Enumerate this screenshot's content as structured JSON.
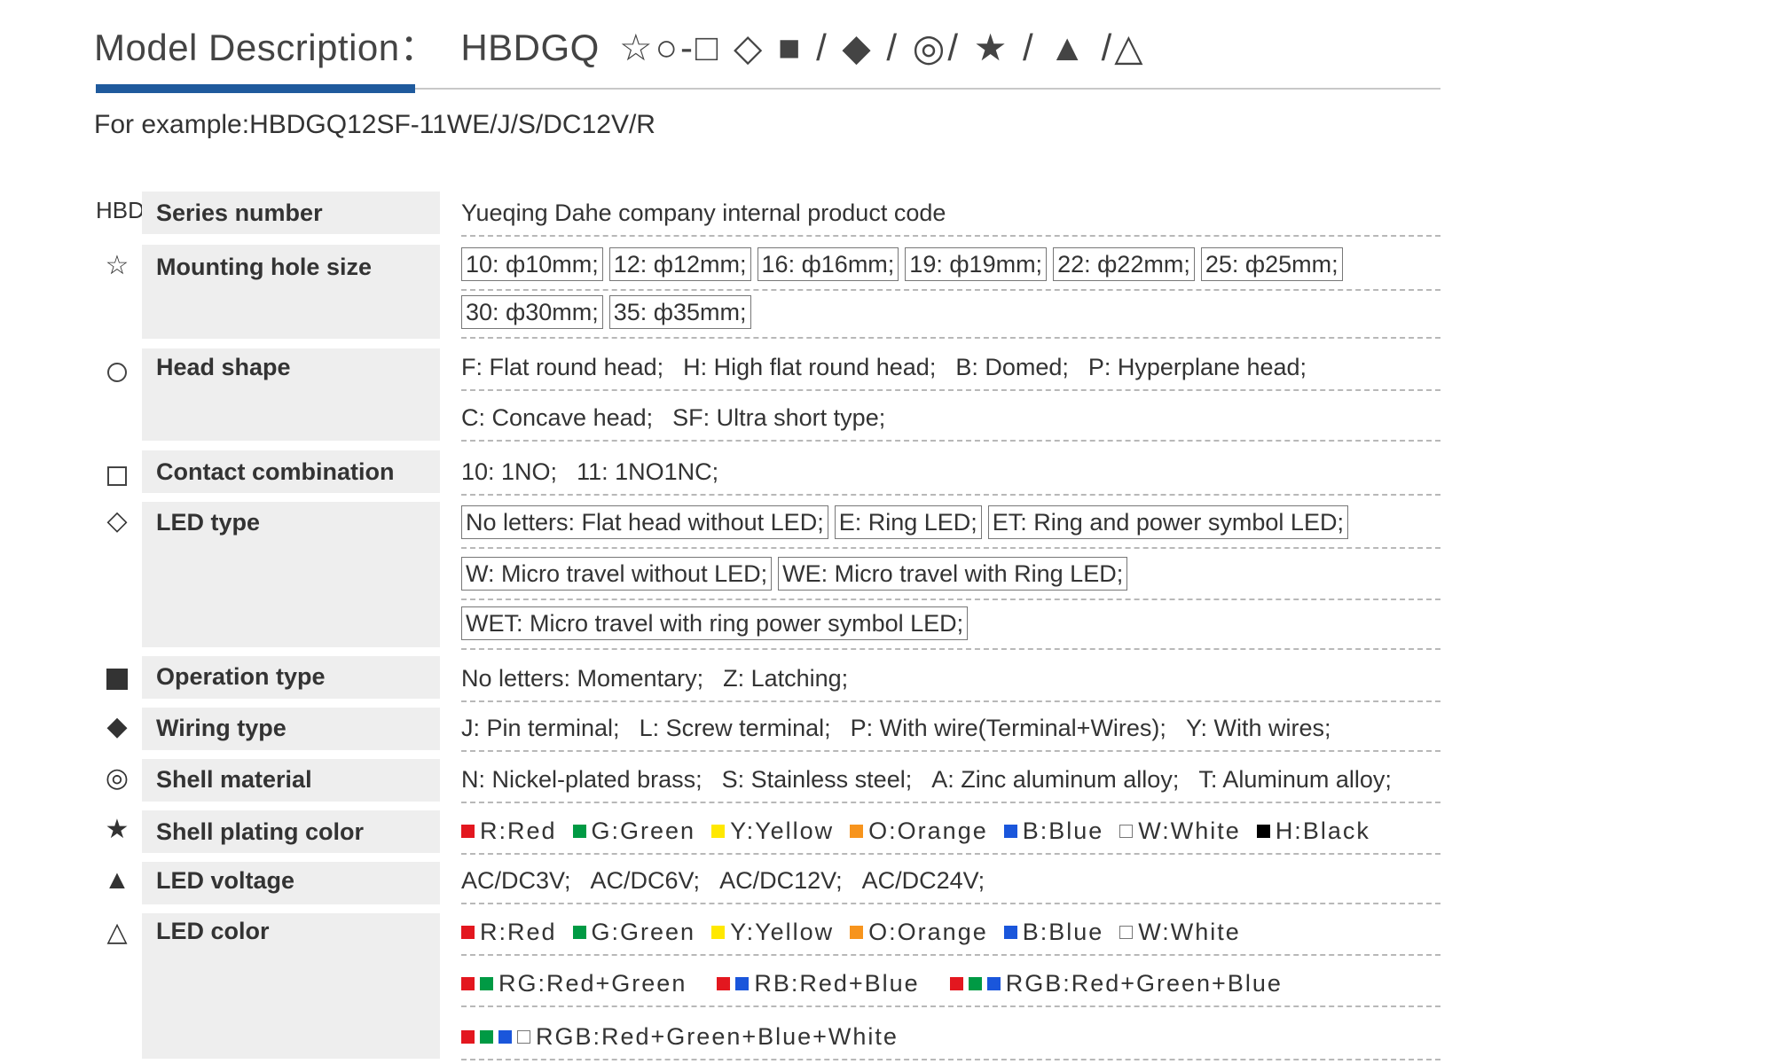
{
  "header": {
    "title": "Model Description：",
    "code": "HBDGQ",
    "symbols": "☆○-□ ◇ ■ / ◆ / ◎/ ★ / ▲ /△",
    "example": "For example:HBDGQ12SF-11WE/J/S/DC12V/R"
  },
  "colors": {
    "accent": "#1f5a9d",
    "red": "#e3171f",
    "green": "#009a44",
    "yellow": "#ffe800",
    "orange": "#f7941d",
    "blue": "#1a56db",
    "white": "#ffffff",
    "black": "#000000"
  },
  "rows": {
    "series": {
      "symbol": "HBDGQ",
      "label": "Series number",
      "line1": "Yueqing Dahe company internal product code"
    },
    "mounting": {
      "symbol": "☆",
      "label": "Mounting hole size",
      "options": [
        "10: ф10mm;",
        "12: ф12mm;",
        "16: ф16mm;",
        "19: ф19mm;",
        "22: ф22mm;",
        "25: ф25mm;",
        "30: ф30mm;",
        "35: ф35mm;"
      ]
    },
    "head": {
      "symbol_icon": "circle-outline-icon",
      "label": "Head  shape",
      "options": [
        "F: Flat round head;",
        "H: High flat round head;",
        "B: Domed;",
        "P: Hyperplane head;",
        "C: Concave head;",
        "SF: Ultra short type;"
      ]
    },
    "contact": {
      "symbol_icon": "square-outline-icon",
      "label": "Contact combination",
      "options": [
        "10: 1NO;",
        "11: 1NO1NC;"
      ]
    },
    "led_type": {
      "symbol": "◇",
      "label": "LED type",
      "options": [
        "No letters: Flat head without LED;",
        "E: Ring LED;",
        "ET: Ring and power symbol LED;",
        "W: Micro travel without LED;",
        "WE: Micro travel with Ring LED;",
        "WET: Micro travel with ring power symbol LED;"
      ]
    },
    "operation": {
      "symbol_icon": "square-filled-icon",
      "label": "Operation type",
      "options": [
        "No letters: Momentary;",
        "Z: Latching;"
      ]
    },
    "wiring": {
      "symbol": "◆",
      "label": "Wiring type",
      "options": [
        "J: Pin terminal;",
        "L: Screw terminal;",
        "P: With wire(Terminal+Wires);",
        "Y: With wires;"
      ]
    },
    "shell_material": {
      "symbol": "◎",
      "label": "Shell material",
      "options": [
        "N: Nickel-plated brass;",
        "S: Stainless steel;",
        "A: Zinc aluminum alloy;",
        "T: Aluminum alloy;"
      ]
    },
    "plating": {
      "symbol": "★",
      "label": "Shell plating color",
      "options": [
        "R:Red",
        "G:Green",
        "Y:Yellow",
        "O:Orange",
        "B:Blue",
        "W:White",
        "H:Black"
      ]
    },
    "voltage": {
      "symbol": "▲",
      "label": "LED voltage",
      "options": [
        "AC/DC3V;",
        "AC/DC6V;",
        "AC/DC12V;",
        "AC/DC24V;"
      ]
    },
    "led_color": {
      "symbol": "△",
      "label": "LED color",
      "options": [
        "R:Red",
        "G:Green",
        "Y:Yellow",
        "O:Orange",
        "B:Blue",
        "W:White",
        "RG:Red+Green",
        "RB:Red+Blue",
        "RGB:Red+Green+Blue",
        "RGB:Red+Green+Blue+White"
      ]
    }
  }
}
